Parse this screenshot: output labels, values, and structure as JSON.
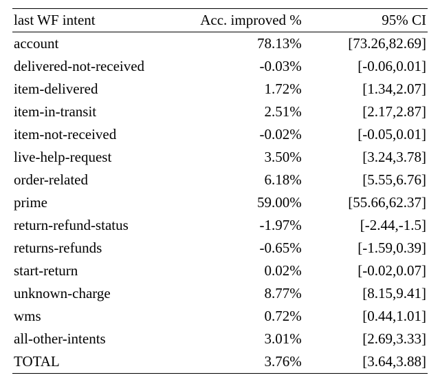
{
  "chart_data": {
    "type": "table",
    "headers": {
      "intent": "last WF intent",
      "acc": "Acc. improved %",
      "ci": "95% CI"
    },
    "rows": [
      {
        "intent": "account",
        "acc": "78.13%",
        "ci": "[73.26,82.69]"
      },
      {
        "intent": "delivered-not-received",
        "acc": "-0.03%",
        "ci": "[-0.06,0.01]"
      },
      {
        "intent": "item-delivered",
        "acc": "1.72%",
        "ci": "[1.34,2.07]"
      },
      {
        "intent": "item-in-transit",
        "acc": "2.51%",
        "ci": "[2.17,2.87]"
      },
      {
        "intent": "item-not-received",
        "acc": "-0.02%",
        "ci": "[-0.05,0.01]"
      },
      {
        "intent": "live-help-request",
        "acc": "3.50%",
        "ci": "[3.24,3.78]"
      },
      {
        "intent": "order-related",
        "acc": "6.18%",
        "ci": "[5.55,6.76]"
      },
      {
        "intent": "prime",
        "acc": "59.00%",
        "ci": "[55.66,62.37]"
      },
      {
        "intent": "return-refund-status",
        "acc": "-1.97%",
        "ci": "[-2.44,-1.5]"
      },
      {
        "intent": "returns-refunds",
        "acc": "-0.65%",
        "ci": "[-1.59,0.39]"
      },
      {
        "intent": "start-return",
        "acc": "0.02%",
        "ci": "[-0.02,0.07]"
      },
      {
        "intent": "unknown-charge",
        "acc": "8.77%",
        "ci": "[8.15,9.41]"
      },
      {
        "intent": "wms",
        "acc": "0.72%",
        "ci": "[0.44,1.01]"
      },
      {
        "intent": "all-other-intents",
        "acc": "3.01%",
        "ci": "[2.69,3.33]"
      },
      {
        "intent": "TOTAL",
        "acc": "3.76%",
        "ci": "[3.64,3.88]"
      }
    ]
  }
}
